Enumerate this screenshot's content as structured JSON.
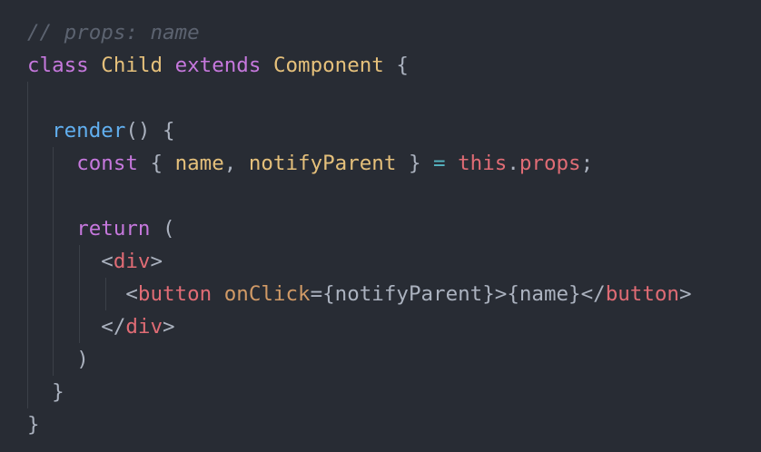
{
  "editor": {
    "language": "JavaScript (JSX)",
    "theme": {
      "background": "#282c34",
      "comment": "#5c6370",
      "keyword": "#c678dd",
      "class_name": "#e5c07b",
      "function": "#61afef",
      "variable": "#e5c07b",
      "punctuation": "#abb2bf",
      "operator": "#56b6c2",
      "this": "#e06c75",
      "property": "#e06c75",
      "tag": "#e06c75",
      "attribute": "#d19a66",
      "indent_guide": "#3b4048"
    },
    "lines": [
      {
        "tokens": [
          {
            "text": "// props: name",
            "type": "comment"
          }
        ]
      },
      {
        "tokens": [
          {
            "text": "class",
            "type": "keyword"
          },
          {
            "text": " ",
            "type": "text"
          },
          {
            "text": "Child",
            "type": "class"
          },
          {
            "text": " ",
            "type": "text"
          },
          {
            "text": "extends",
            "type": "keyword"
          },
          {
            "text": " ",
            "type": "text"
          },
          {
            "text": "Component",
            "type": "class"
          },
          {
            "text": " {",
            "type": "punct"
          }
        ]
      },
      {
        "tokens": []
      },
      {
        "tokens": [
          {
            "text": "  ",
            "type": "text"
          },
          {
            "text": "render",
            "type": "func"
          },
          {
            "text": "() {",
            "type": "punct"
          }
        ]
      },
      {
        "tokens": [
          {
            "text": "    ",
            "type": "text"
          },
          {
            "text": "const",
            "type": "keyword"
          },
          {
            "text": " { ",
            "type": "punct"
          },
          {
            "text": "name",
            "type": "var"
          },
          {
            "text": ", ",
            "type": "punct"
          },
          {
            "text": "notifyParent",
            "type": "var"
          },
          {
            "text": " } ",
            "type": "punct"
          },
          {
            "text": "=",
            "type": "op"
          },
          {
            "text": " ",
            "type": "text"
          },
          {
            "text": "this",
            "type": "this"
          },
          {
            "text": ".",
            "type": "punct"
          },
          {
            "text": "props",
            "type": "prop"
          },
          {
            "text": ";",
            "type": "punct"
          }
        ]
      },
      {
        "tokens": []
      },
      {
        "tokens": [
          {
            "text": "    ",
            "type": "text"
          },
          {
            "text": "return",
            "type": "keyword"
          },
          {
            "text": " (",
            "type": "punct"
          }
        ]
      },
      {
        "tokens": [
          {
            "text": "      ",
            "type": "text"
          },
          {
            "text": "<",
            "type": "punct"
          },
          {
            "text": "div",
            "type": "tag"
          },
          {
            "text": ">",
            "type": "punct"
          }
        ]
      },
      {
        "tokens": [
          {
            "text": "        ",
            "type": "text"
          },
          {
            "text": "<",
            "type": "punct"
          },
          {
            "text": "button",
            "type": "tag"
          },
          {
            "text": " ",
            "type": "text"
          },
          {
            "text": "onClick",
            "type": "attr"
          },
          {
            "text": "=",
            "type": "punct"
          },
          {
            "text": "{notifyParent}",
            "type": "text"
          },
          {
            "text": ">",
            "type": "punct"
          },
          {
            "text": "{name}",
            "type": "text"
          },
          {
            "text": "</",
            "type": "punct"
          },
          {
            "text": "button",
            "type": "tag"
          },
          {
            "text": ">",
            "type": "punct"
          }
        ]
      },
      {
        "tokens": [
          {
            "text": "      ",
            "type": "text"
          },
          {
            "text": "</",
            "type": "punct"
          },
          {
            "text": "div",
            "type": "tag"
          },
          {
            "text": ">",
            "type": "punct"
          }
        ]
      },
      {
        "tokens": [
          {
            "text": "    ",
            "type": "text"
          },
          {
            "text": ")",
            "type": "punct"
          }
        ]
      },
      {
        "tokens": [
          {
            "text": "  ",
            "type": "text"
          },
          {
            "text": "}",
            "type": "punct"
          }
        ]
      },
      {
        "tokens": [
          {
            "text": "}",
            "type": "punct"
          }
        ]
      }
    ]
  }
}
